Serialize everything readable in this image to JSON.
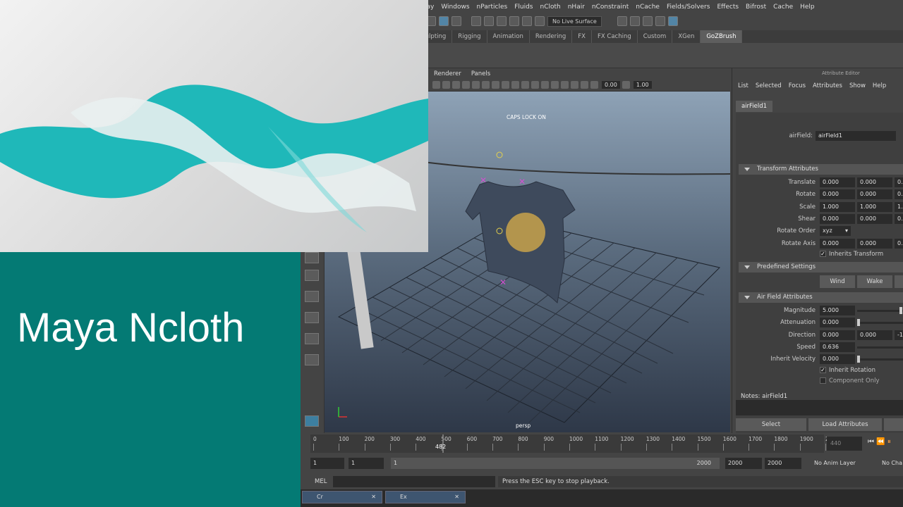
{
  "menubar": [
    "lay",
    "Windows",
    "nParticles",
    "Fluids",
    "nCloth",
    "nHair",
    "nConstraint",
    "nCache",
    "Fields/Solvers",
    "Effects",
    "Bifrost",
    "Cache",
    "Help"
  ],
  "statusline": {
    "live_surface": "No Live Surface"
  },
  "shelf_tabs": [
    "culpting",
    "Rigging",
    "Animation",
    "Rendering",
    "FX",
    "FX Caching",
    "Custom",
    "XGen",
    "GoZBrush"
  ],
  "panel_menu": [
    "Renderer",
    "Panels"
  ],
  "view_toolbar": {
    "field1": "0.00",
    "field2": "1.00"
  },
  "viewport": {
    "caps_lock": "CAPS LOCK ON",
    "camera": "persp"
  },
  "attribute_editor": {
    "title": "Attribute Editor",
    "menu": [
      "List",
      "Selected",
      "Focus",
      "Attributes",
      "Show",
      "Help"
    ],
    "tab": "airField1",
    "node_label": "airField:",
    "node_value": "airField1",
    "sections": {
      "transform": "Transform Attributes",
      "predefined": "Predefined Settings",
      "air_field": "Air Field Attributes"
    },
    "transform_rows": [
      {
        "label": "Translate",
        "values": [
          "0.000",
          "0.000",
          "0.0"
        ]
      },
      {
        "label": "Rotate",
        "values": [
          "0.000",
          "0.000",
          "0.0"
        ]
      },
      {
        "label": "Scale",
        "values": [
          "1.000",
          "1.000",
          "1.0"
        ]
      },
      {
        "label": "Shear",
        "values": [
          "0.000",
          "0.000",
          "0.0"
        ]
      }
    ],
    "rotate_order_label": "Rotate Order",
    "rotate_order_value": "xyz",
    "rotate_axis_label": "Rotate Axis",
    "rotate_axis_values": [
      "0.000",
      "0.000",
      "0.0"
    ],
    "inherits_transform": "Inherits Transform",
    "predefined_buttons": [
      "Wind",
      "Wake"
    ],
    "air_rows": {
      "magnitude": {
        "label": "Magnitude",
        "value": "5.000"
      },
      "attenuation": {
        "label": "Attenuation",
        "value": "0.000"
      },
      "direction": {
        "label": "Direction",
        "values": [
          "0.000",
          "0.000",
          "-1"
        ]
      },
      "speed": {
        "label": "Speed",
        "value": "0.636"
      },
      "inherit_velocity": {
        "label": "Inherit Velocity",
        "value": "0.000"
      }
    },
    "inherit_rotation": "Inherit Rotation",
    "component_only": "Component Only",
    "notes": "Notes: airField1",
    "select_button": "Select",
    "load_button": "Load Attributes"
  },
  "timeline": {
    "ticks": [
      "0",
      "100",
      "200",
      "300",
      "400",
      "500",
      "600",
      "700",
      "800",
      "900",
      "1000",
      "1100",
      "1200",
      "1300",
      "1400",
      "1500",
      "1600",
      "1700",
      "1800",
      "1900",
      "2"
    ],
    "current_frame": "482",
    "current_field": "440"
  },
  "range": {
    "start": "1",
    "start2": "1",
    "inner_start": "1",
    "inner_end": "2000",
    "end": "2000",
    "end2": "2000",
    "anim_layer": "No Anim Layer",
    "character": "No Cha"
  },
  "command": {
    "mel": "MEL",
    "help": "Press the ESC key to stop playback."
  },
  "taskbar": [
    "Cr",
    "Ex"
  ],
  "overlay": {
    "title": "Maya Ncloth"
  },
  "colors": {
    "teal": "#047a74",
    "cloth": "#1fb8b9"
  }
}
